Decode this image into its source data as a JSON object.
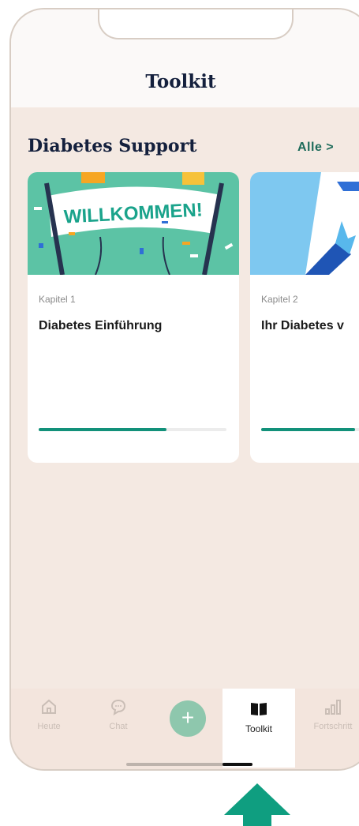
{
  "header": {
    "title": "Toolkit"
  },
  "section": {
    "title": "Diabetes Support",
    "see_all": "Alle >"
  },
  "cards": [
    {
      "chapter": "Kapitel 1",
      "title": "Diabetes Einführung",
      "banner": "WILLKOMMEN!",
      "progress": 0.68
    },
    {
      "chapter": "Kapitel 2",
      "title": "Ihr Diabetes v",
      "progress": 0.5
    }
  ],
  "tabbar": {
    "items": [
      {
        "label": "Heute",
        "icon": "home-icon"
      },
      {
        "label": "Chat",
        "icon": "chat-icon"
      },
      {
        "label": "",
        "icon": "plus-icon"
      },
      {
        "label": "Toolkit",
        "icon": "book-icon"
      },
      {
        "label": "Fortschritt",
        "icon": "bar-chart-icon"
      }
    ],
    "active": "Toolkit"
  },
  "colors": {
    "accent": "#12917a",
    "background": "#f4e9e2",
    "title": "#14203d",
    "arrow": "#0f9e80"
  }
}
